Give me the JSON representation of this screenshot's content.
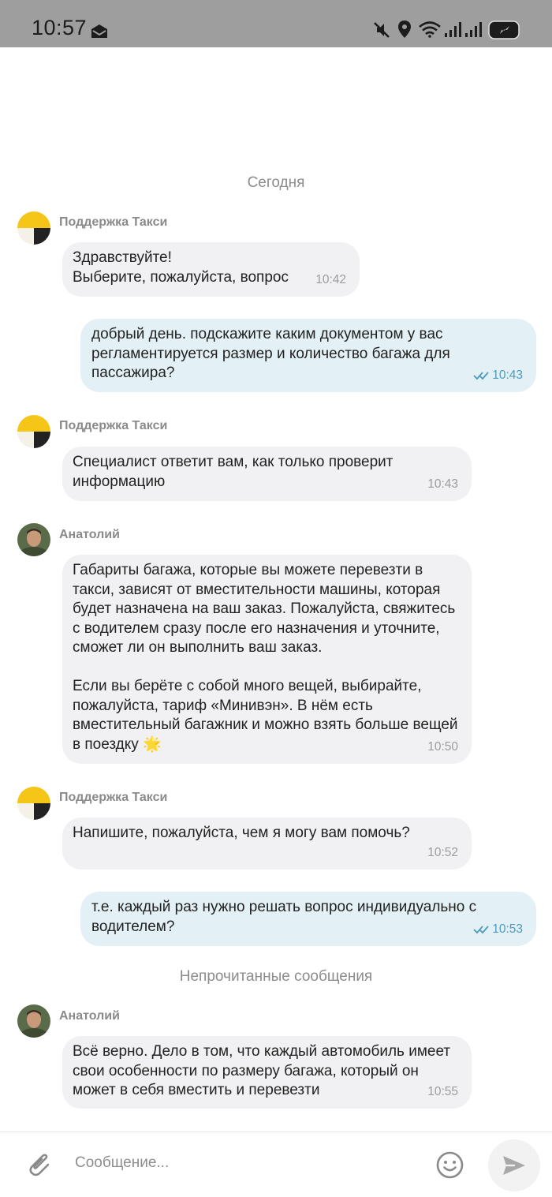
{
  "status_bar": {
    "time": "10:57",
    "icons": [
      "mail-icon",
      "mute-icon",
      "location-icon",
      "wifi-icon",
      "signal-icon",
      "signal-icon",
      "battery-icon"
    ]
  },
  "chat": {
    "date_separator": "Сегодня",
    "unread_separator": "Непрочитанные сообщения",
    "messages": [
      {
        "sender": "Поддержка Такси",
        "text": "Здравствуйте!\nВыберите, пожалуйста, вопрос",
        "time": "10:42"
      },
      {
        "text": "добрый день. подскажите каким документом у вас регламентируется размер и количество багажа для пассажира?",
        "time": "10:43",
        "status": "read"
      },
      {
        "sender": "Поддержка Такси",
        "text": "Специалист ответит вам, как только проверит информацию",
        "time": "10:43"
      },
      {
        "sender": "Анатолий",
        "text": "Габариты багажа, которые вы можете перевезти в такси, зависят от вместительности машины, которая будет назначена на ваш заказ. Пожалуйста, свяжитесь с водителем сразу после его назначения и уточните, сможет ли он выполнить ваш заказ.\n\nЕсли вы берёте с собой много вещей, выбирайте, пожалуйста, тариф «Минивэн». В нём есть вместительный багажник и можно взять больше вещей в поездку 🌟",
        "time": "10:50"
      },
      {
        "sender": "Поддержка Такси",
        "text": "Напишите, пожалуйста, чем я могу вам помочь?",
        "time": "10:52"
      },
      {
        "text": "т.е. каждый раз нужно решать вопрос индивидуально с водителем?",
        "time": "10:53",
        "status": "read"
      },
      {
        "sender": "Анатолий",
        "text": "Всё верно. Дело в том, что каждый автомобиль имеет свои особенности по размеру багажа, который он может в себя вместить и перевезти",
        "time": "10:55"
      }
    ]
  },
  "composer": {
    "placeholder": "Сообщение...",
    "icons": [
      "attach-icon",
      "emoji-icon",
      "send-icon"
    ]
  },
  "colors": {
    "status_bar_bg": "#9e9e9e",
    "incoming_bubble": "#f1f1f3",
    "outgoing_bubble": "#e3f1f7",
    "outgoing_time": "#4d9bbd",
    "brand_yellow": "#f5c518"
  }
}
